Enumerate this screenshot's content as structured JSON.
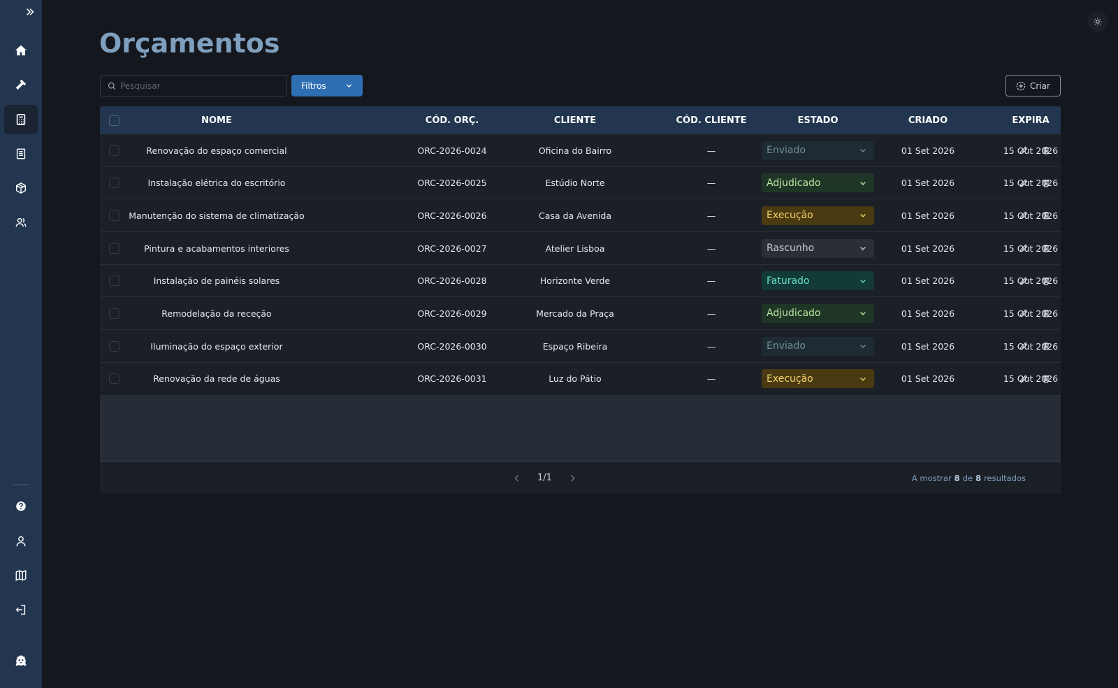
{
  "page": {
    "title": "Orçamentos"
  },
  "toolbar": {
    "search_placeholder": "Pesquisar",
    "filters_label": "Filtros",
    "create_label": "Criar"
  },
  "sidebar": {
    "top_items": [
      {
        "name": "home",
        "icon": "home-icon"
      },
      {
        "name": "tools",
        "icon": "hammer-icon"
      },
      {
        "name": "budgets",
        "icon": "calculator-icon",
        "active": true
      },
      {
        "name": "documents",
        "icon": "document-icon"
      },
      {
        "name": "products",
        "icon": "box-icon"
      },
      {
        "name": "clients",
        "icon": "users-icon"
      }
    ],
    "bottom_items": [
      {
        "name": "help",
        "icon": "help-icon"
      },
      {
        "name": "profile",
        "icon": "user-icon"
      },
      {
        "name": "map",
        "icon": "map-icon"
      },
      {
        "name": "logout",
        "icon": "logout-icon"
      },
      {
        "name": "brand",
        "icon": "mascot-logo-icon"
      }
    ]
  },
  "table": {
    "columns": [
      "NOME",
      "CÓD. ORÇ.",
      "CLIENTE",
      "CÓD. CLIENTE",
      "ESTADO",
      "CRIADO",
      "EXPIRA"
    ],
    "rows": [
      {
        "nome": "Renovação do espaço comercial",
        "cod": "ORC-2026-0024",
        "cliente": "Oficina do Bairro",
        "cod_cliente": "—",
        "estado": "Enviado",
        "criado": "01 Set 2026",
        "expira": "15 Out 2026"
      },
      {
        "nome": "Instalação elétrica do escritório",
        "cod": "ORC-2026-0025",
        "cliente": "Estúdio Norte",
        "cod_cliente": "—",
        "estado": "Adjudicado",
        "criado": "01 Set 2026",
        "expira": "15 Out 2026"
      },
      {
        "nome": "Manutenção do sistema de climatização",
        "cod": "ORC-2026-0026",
        "cliente": "Casa da Avenida",
        "cod_cliente": "—",
        "estado": "Execução",
        "criado": "01 Set 2026",
        "expira": "15 Out 2026"
      },
      {
        "nome": "Pintura e acabamentos interiores",
        "cod": "ORC-2026-0027",
        "cliente": "Atelier Lisboa",
        "cod_cliente": "—",
        "estado": "Rascunho",
        "criado": "01 Set 2026",
        "expira": "15 Out 2026"
      },
      {
        "nome": "Instalação de painéis solares",
        "cod": "ORC-2026-0028",
        "cliente": "Horizonte Verde",
        "cod_cliente": "—",
        "estado": "Faturado",
        "criado": "01 Set 2026",
        "expira": "15 Out 2026"
      },
      {
        "nome": "Remodelação da receção",
        "cod": "ORC-2026-0029",
        "cliente": "Mercado da Praça",
        "cod_cliente": "—",
        "estado": "Adjudicado",
        "criado": "01 Set 2026",
        "expira": "15 Out 2026"
      },
      {
        "nome": "Iluminação do espaço exterior",
        "cod": "ORC-2026-0030",
        "cliente": "Espaço Ribeira",
        "cod_cliente": "—",
        "estado": "Enviado",
        "criado": "01 Set 2026",
        "expira": "15 Out 2026"
      },
      {
        "nome": "Renovação da rede de águas",
        "cod": "ORC-2026-0031",
        "cliente": "Luz do Pátio",
        "cod_cliente": "—",
        "estado": "Execução",
        "criado": "01 Set 2026",
        "expira": "15 Out 2026"
      }
    ]
  },
  "status_styles": {
    "Enviado": {
      "bg": "#1f2b33",
      "fg": "#6c8d99"
    },
    "Adjudicado": {
      "bg": "#1f3626",
      "fg": "#b9e6a2"
    },
    "Execução": {
      "bg": "#4a3a12",
      "fg": "#f3d26a"
    },
    "Rascunho": {
      "bg": "#2a2e35",
      "fg": "#c7ccd4"
    },
    "Faturado": {
      "bg": "#123b38",
      "fg": "#67e0c8"
    }
  },
  "pagination": {
    "page": "1/1",
    "results_prefix": "A mostrar",
    "shown": "8",
    "of": "de",
    "total": "8",
    "results_suffix": "resultados"
  }
}
